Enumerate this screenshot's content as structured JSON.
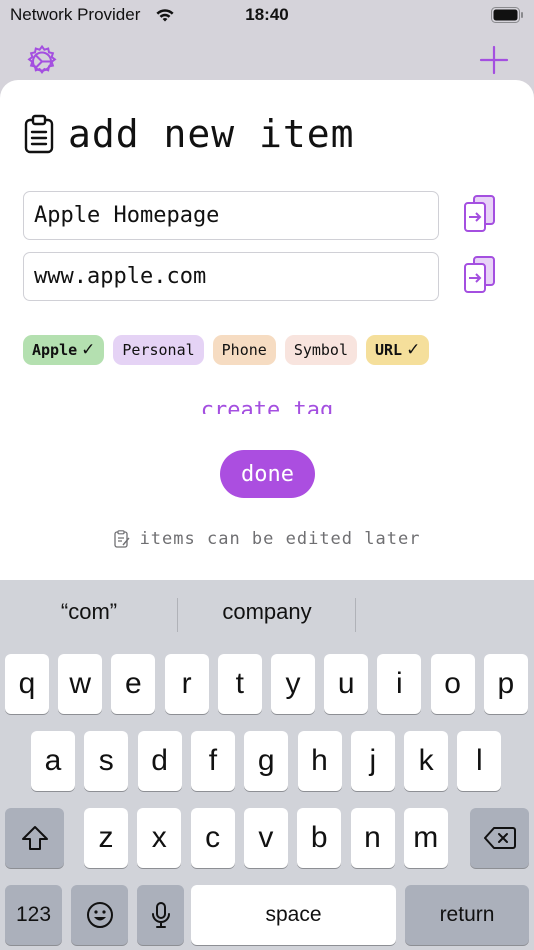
{
  "status_bar": {
    "carrier": "Network Provider",
    "time": "18:40"
  },
  "sheet": {
    "title": "add new item",
    "name_field_value": "Apple Homepage",
    "url_field_value": "www.apple.com",
    "tags": [
      {
        "label": "Apple",
        "selected": true,
        "color": "#b4e0b0"
      },
      {
        "label": "Personal",
        "selected": false,
        "color": "#e5d3f5"
      },
      {
        "label": "Phone",
        "selected": false,
        "color": "#f6dcc2"
      },
      {
        "label": "Symbol",
        "selected": false,
        "color": "#f8e4de"
      },
      {
        "label": "URL",
        "selected": true,
        "color": "#f5df9b"
      }
    ],
    "check_mark": "✓",
    "create_tag_label": "create tag",
    "done_label": "done",
    "hint": "items can be edited later"
  },
  "colors": {
    "accent": "#a44fe0",
    "done_button": "#ab4ee0"
  },
  "keyboard": {
    "suggestions": [
      "“com”",
      "company",
      ""
    ],
    "row1": [
      "q",
      "w",
      "e",
      "r",
      "t",
      "y",
      "u",
      "i",
      "o",
      "p"
    ],
    "row2": [
      "a",
      "s",
      "d",
      "f",
      "g",
      "h",
      "j",
      "k",
      "l"
    ],
    "row3": [
      "z",
      "x",
      "c",
      "v",
      "b",
      "n",
      "m"
    ],
    "numbers_label": "123",
    "space_label": "space",
    "return_label": "return"
  }
}
